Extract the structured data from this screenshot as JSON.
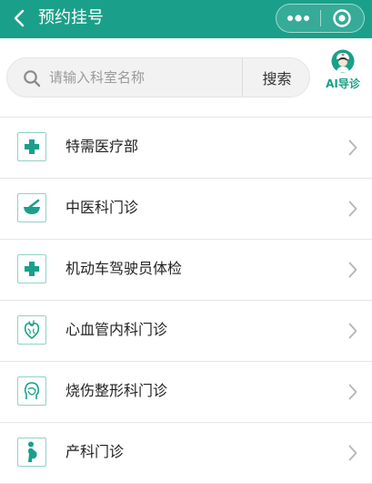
{
  "header": {
    "title": "预约挂号",
    "back_icon": "chevron-left-icon",
    "more_icon": "more-dots-icon",
    "close_icon": "target-circle-icon",
    "background_color": "#1aa08a"
  },
  "search": {
    "placeholder": "请输入科室名称",
    "value": "",
    "button_label": "搜索",
    "icon": "search-icon"
  },
  "ai_guide": {
    "label": "AI导诊",
    "icon": "nurse-avatar-icon",
    "color": "#1aa08a"
  },
  "departments": [
    {
      "label": "特需医疗部",
      "icon": "cross-icon"
    },
    {
      "label": "中医科门诊",
      "icon": "mortar-pestle-icon"
    },
    {
      "label": "机动车驾驶员体检",
      "icon": "cross-icon"
    },
    {
      "label": "心血管内科门诊",
      "icon": "heart-icon"
    },
    {
      "label": "烧伤整形科门诊",
      "icon": "face-profile-icon"
    },
    {
      "label": "产科门诊",
      "icon": "pregnant-icon"
    }
  ],
  "accent_color": "#1aa08a"
}
